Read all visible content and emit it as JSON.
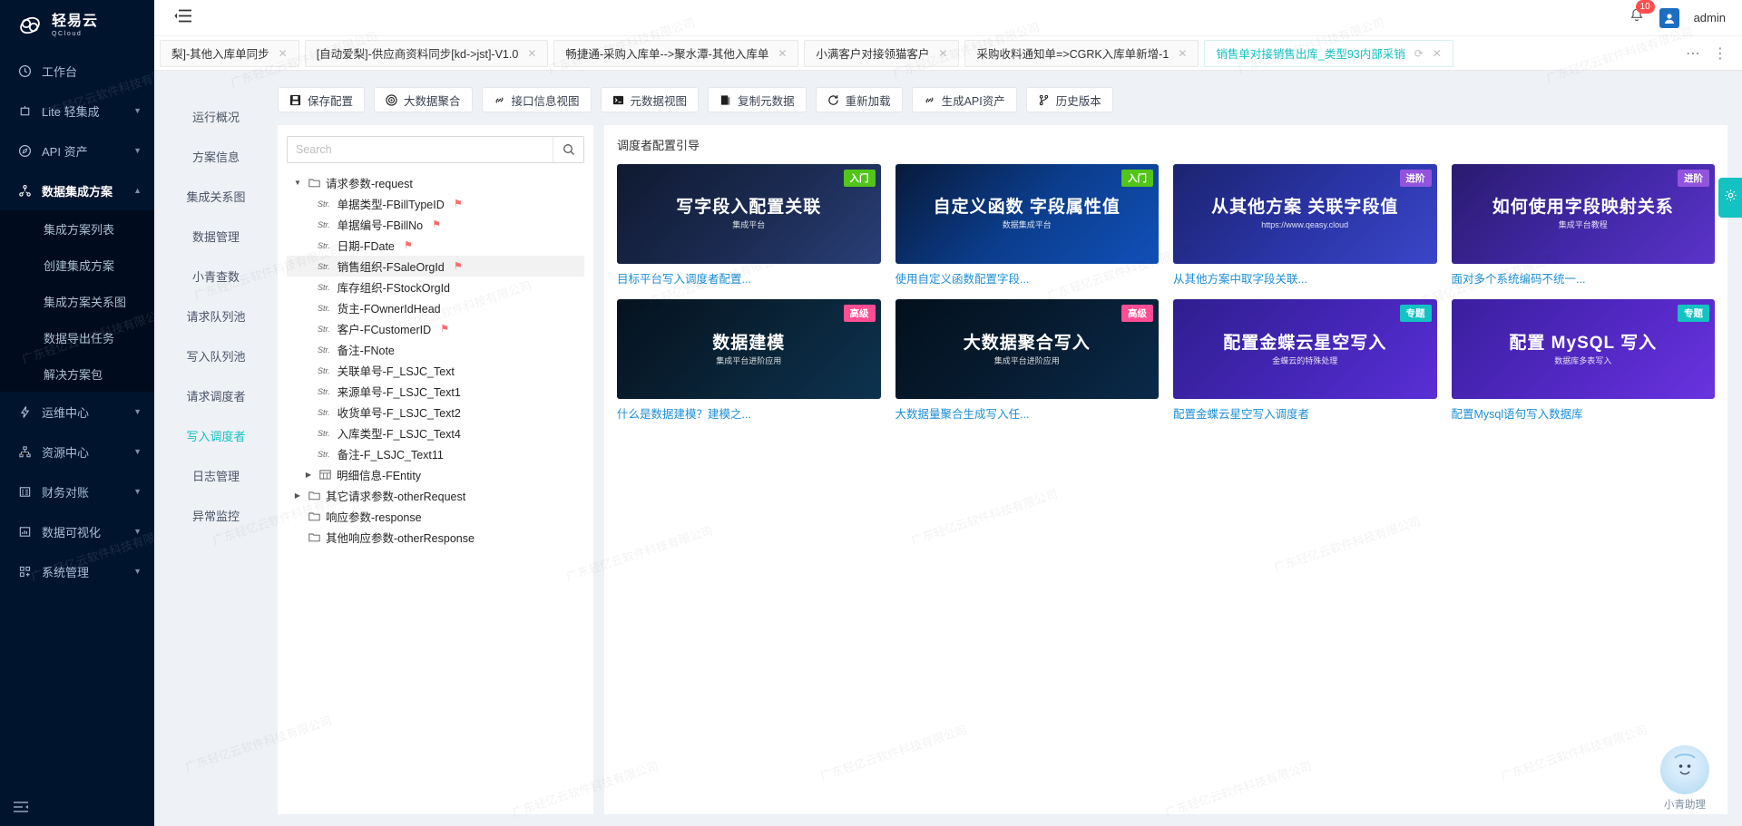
{
  "brand": {
    "name": "轻易云",
    "sub": "QCloud"
  },
  "topbar": {
    "notifications": "10",
    "user": "admin"
  },
  "sidebar": {
    "items": [
      {
        "label": "工作台",
        "icon": "clock-icon",
        "expandable": false
      },
      {
        "label": "Lite 轻集成",
        "icon": "lite-icon",
        "expandable": true
      },
      {
        "label": "API 资产",
        "icon": "compass-icon",
        "expandable": true
      },
      {
        "label": "数据集成方案",
        "icon": "nodes-icon",
        "expandable": true,
        "active": true
      },
      {
        "label": "运维中心",
        "icon": "bolt-icon",
        "expandable": true
      },
      {
        "label": "资源中心",
        "icon": "sitemap-icon",
        "expandable": true
      },
      {
        "label": "财务对账",
        "icon": "ledger-icon",
        "expandable": true
      },
      {
        "label": "数据可视化",
        "icon": "chart-icon",
        "expandable": true
      },
      {
        "label": "系统管理",
        "icon": "grid-icon",
        "expandable": true
      }
    ],
    "sub_items": [
      {
        "label": "集成方案列表"
      },
      {
        "label": "创建集成方案"
      },
      {
        "label": "集成方案关系图"
      },
      {
        "label": "数据导出任务"
      },
      {
        "label": "解决方案包"
      }
    ]
  },
  "tabs": [
    {
      "label": "梨]-其他入库单同步",
      "active": false
    },
    {
      "label": "[自动爱梨]-供应商资料同步[kd->jst]-V1.0",
      "active": false
    },
    {
      "label": "畅捷通-采购入库单-->聚水潭-其他入库单",
      "active": false
    },
    {
      "label": "小满客户对接领猫客户",
      "active": false
    },
    {
      "label": "采购收料通知单=>CGRK入库单新增-1",
      "active": false
    },
    {
      "label": "销售单对接销售出库_类型93内部采销",
      "active": true
    }
  ],
  "submenu": {
    "items": [
      {
        "label": "运行概况"
      },
      {
        "label": "方案信息"
      },
      {
        "label": "集成关系图"
      },
      {
        "label": "数据管理"
      },
      {
        "label": "小青查数"
      },
      {
        "label": "请求队列池"
      },
      {
        "label": "写入队列池"
      },
      {
        "label": "请求调度者"
      },
      {
        "label": "写入调度者",
        "active": true
      },
      {
        "label": "日志管理"
      },
      {
        "label": "异常监控"
      }
    ]
  },
  "toolbar": {
    "buttons": [
      {
        "label": "保存配置",
        "icon": "save-icon"
      },
      {
        "label": "大数据聚合",
        "icon": "aggregate-icon"
      },
      {
        "label": "接口信息视图",
        "icon": "link-icon"
      },
      {
        "label": "元数据视图",
        "icon": "terminal-icon"
      },
      {
        "label": "复制元数据",
        "icon": "copy-icon"
      },
      {
        "label": "重新加载",
        "icon": "reload-icon"
      },
      {
        "label": "生成API资产",
        "icon": "link-icon"
      },
      {
        "label": "历史版本",
        "icon": "branch-icon"
      }
    ]
  },
  "tree": {
    "search_placeholder": "Search",
    "nodes": [
      {
        "level": 0,
        "type": "folder",
        "caret": "down",
        "label": "请求参数-request",
        "flag": false
      },
      {
        "level": 1,
        "type": "Str.",
        "label": "单据类型-FBillTypeID",
        "flag": true
      },
      {
        "level": 1,
        "type": "Str.",
        "label": "单据编号-FBillNo",
        "flag": true
      },
      {
        "level": 1,
        "type": "Str.",
        "label": "日期-FDate",
        "flag": true
      },
      {
        "level": 1,
        "type": "Str.",
        "label": "销售组织-FSaleOrgId",
        "flag": true,
        "selected": true
      },
      {
        "level": 1,
        "type": "Str.",
        "label": "库存组织-FStockOrgId",
        "flag": false
      },
      {
        "level": 1,
        "type": "Str.",
        "label": "货主-FOwnerIdHead",
        "flag": false
      },
      {
        "level": 1,
        "type": "Str.",
        "label": "客户-FCustomerID",
        "flag": true
      },
      {
        "level": 1,
        "type": "Str.",
        "label": "备注-FNote",
        "flag": false
      },
      {
        "level": 1,
        "type": "Str.",
        "label": "关联单号-F_LSJC_Text",
        "flag": false
      },
      {
        "level": 1,
        "type": "Str.",
        "label": "来源单号-F_LSJC_Text1",
        "flag": false
      },
      {
        "level": 1,
        "type": "Str.",
        "label": "收货单号-F_LSJC_Text2",
        "flag": false
      },
      {
        "level": 1,
        "type": "Str.",
        "label": "入库类型-F_LSJC_Text4",
        "flag": false
      },
      {
        "level": 1,
        "type": "Str.",
        "label": "备注-F_LSJC_Text11",
        "flag": false
      },
      {
        "level": 1,
        "type": "table",
        "caret": "right",
        "label": "明细信息-FEntity",
        "flag": false
      },
      {
        "level": 0,
        "type": "folder",
        "caret": "right",
        "label": "其它请求参数-otherRequest",
        "flag": false
      },
      {
        "level": 0,
        "type": "folder",
        "caret": "none",
        "label": "响应参数-response",
        "flag": false
      },
      {
        "level": 0,
        "type": "folder",
        "caret": "none",
        "label": "其他响应参数-otherResponse",
        "flag": false
      }
    ]
  },
  "cards": {
    "title": "调度者配置引导",
    "items": [
      {
        "caption": "目标平台写入调度者配置...",
        "badge": "入门",
        "badge_color": "#52c41a",
        "img_title": "写字段入配置关联",
        "img_sub": "集成平台",
        "bg": "linear-gradient(135deg,#0f1930 0%,#1b2b52 55%,#2a3f78 100%)"
      },
      {
        "caption": "使用自定义函数配置字段...",
        "badge": "入门",
        "badge_color": "#52c41a",
        "img_title": "自定义函数 字段属性值",
        "img_sub": "数据集成平台",
        "bg": "linear-gradient(135deg,#081a3a 0%,#0b3d8c 50%,#1150b8 100%)"
      },
      {
        "caption": "从其他方案中取字段关联...",
        "badge": "进阶",
        "badge_color": "#9254de",
        "img_title": "从其他方案 关联字段值",
        "img_sub": "https://www.qeasy.cloud",
        "bg": "linear-gradient(135deg,#1b2470 0%,#2b35a8 55%,#3a46c8 100%)"
      },
      {
        "caption": "面对多个系统编码不统一...",
        "badge": "进阶",
        "badge_color": "#9254de",
        "img_title": "如何使用字段映射关系",
        "img_sub": "集成平台教程",
        "bg": "linear-gradient(135deg,#2a1b6e 0%,#4228a8 55%,#5b33c8 100%)"
      },
      {
        "caption": "什么是数据建模？建模之...",
        "badge": "高级",
        "badge_color": "#ff4d94",
        "img_title": "数据建模",
        "img_sub": "集成平台进阶应用",
        "bg": "linear-gradient(135deg,#05121f 0%,#0a2438 55%,#0d3350 100%)"
      },
      {
        "caption": "大数据量聚合生成写入任...",
        "badge": "高级",
        "badge_color": "#ff4d94",
        "img_title": "大数据聚合写入",
        "img_sub": "集成平台进阶应用",
        "bg": "linear-gradient(135deg,#03101c 0%,#071d33 55%,#0a2a4a 100%)"
      },
      {
        "caption": "配置金蝶云星空写入调度者",
        "badge": "专题",
        "badge_color": "#13c2c2",
        "img_title": "配置金蝶云星空写入",
        "img_sub": "金蝶云的特殊处理",
        "bg": "linear-gradient(135deg,#2f1e8e 0%,#4526b8 55%,#5a2fd6 100%)"
      },
      {
        "caption": "配置Mysql语句写入数据库",
        "badge": "专题",
        "badge_color": "#13c2c2",
        "img_title": "配置 MySQL 写入",
        "img_sub": "数据库多表写入",
        "bg": "linear-gradient(135deg,#3a1f9e 0%,#5328c4 55%,#6a33e0 100%)"
      }
    ]
  },
  "assistant": {
    "label": "小青助理"
  },
  "watermark": {
    "text": "广东轻亿云软件科技有限公司"
  }
}
